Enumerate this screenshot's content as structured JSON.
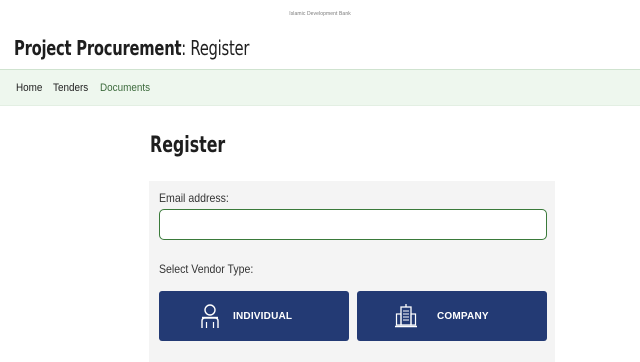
{
  "header": {
    "tagline": "Islamic Development Bank",
    "title_bold": "Project Procurement",
    "title_rest": ": Register"
  },
  "nav": {
    "items": [
      {
        "label": "Home"
      },
      {
        "label": "Tenders"
      },
      {
        "label": "Documents"
      }
    ]
  },
  "main": {
    "title": "Register",
    "email_label": "Email address:",
    "email_value": "",
    "vendor_type_label": "Select Vendor Type:",
    "buttons": {
      "individual": {
        "label": "INDIVIDUAL",
        "icon": "person-icon"
      },
      "company": {
        "label": "COMPANY",
        "icon": "building-icon"
      }
    }
  },
  "colors": {
    "nav_bg": "#eef7ee",
    "input_border": "#3a7a3a",
    "button_bg": "#233a74"
  }
}
